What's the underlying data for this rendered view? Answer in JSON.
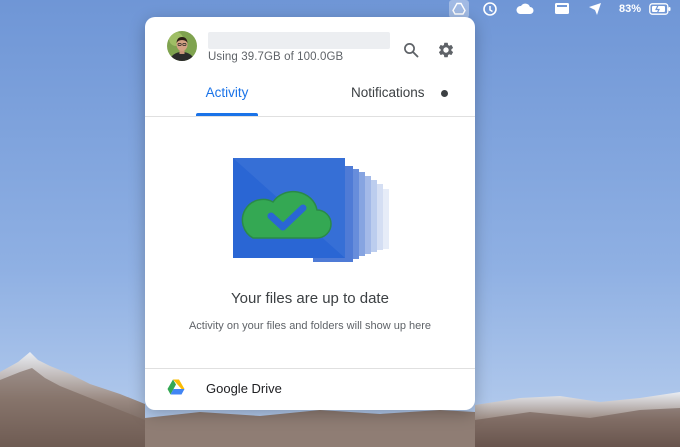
{
  "menubar": {
    "icons": [
      "google-drive-icon",
      "sync-icon",
      "cloud-icon",
      "display-icon",
      "location-icon",
      "battery-icon"
    ],
    "battery_percent": "83%"
  },
  "account": {
    "storage_text": "Using 39.7GB of 100.0GB"
  },
  "header": {
    "search_icon": "search-icon",
    "settings_icon": "gear-icon"
  },
  "tabs": [
    {
      "label": "Activity",
      "selected": true
    },
    {
      "label": "Notifications",
      "selected": false
    }
  ],
  "status": {
    "headline": "Your files are up to date",
    "subline": "Activity on your files and folders will show up here"
  },
  "footer": {
    "label": "Google Drive"
  },
  "colors": {
    "accent": "#1a73e8",
    "sync_blue": "#2a66d4",
    "sync_green": "#34a853"
  }
}
